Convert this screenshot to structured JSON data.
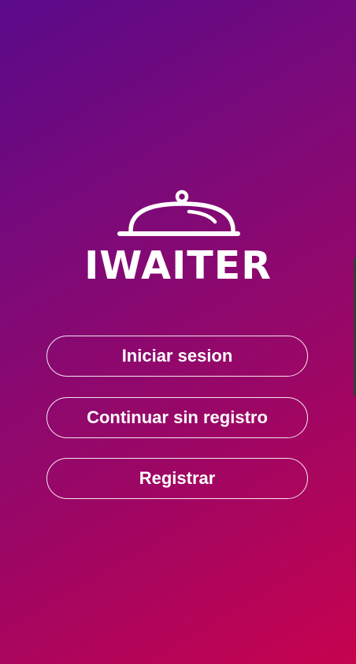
{
  "app": {
    "brand_name": "IWAITER",
    "logo_icon": "cloche-icon"
  },
  "actions": {
    "login_label": "Iniciar sesion",
    "guest_label": "Continuar sin registro",
    "register_label": "Registrar"
  },
  "colors": {
    "gradient_start": "#5a0a8a",
    "gradient_end": "#c6034f",
    "text": "#ffffff"
  }
}
